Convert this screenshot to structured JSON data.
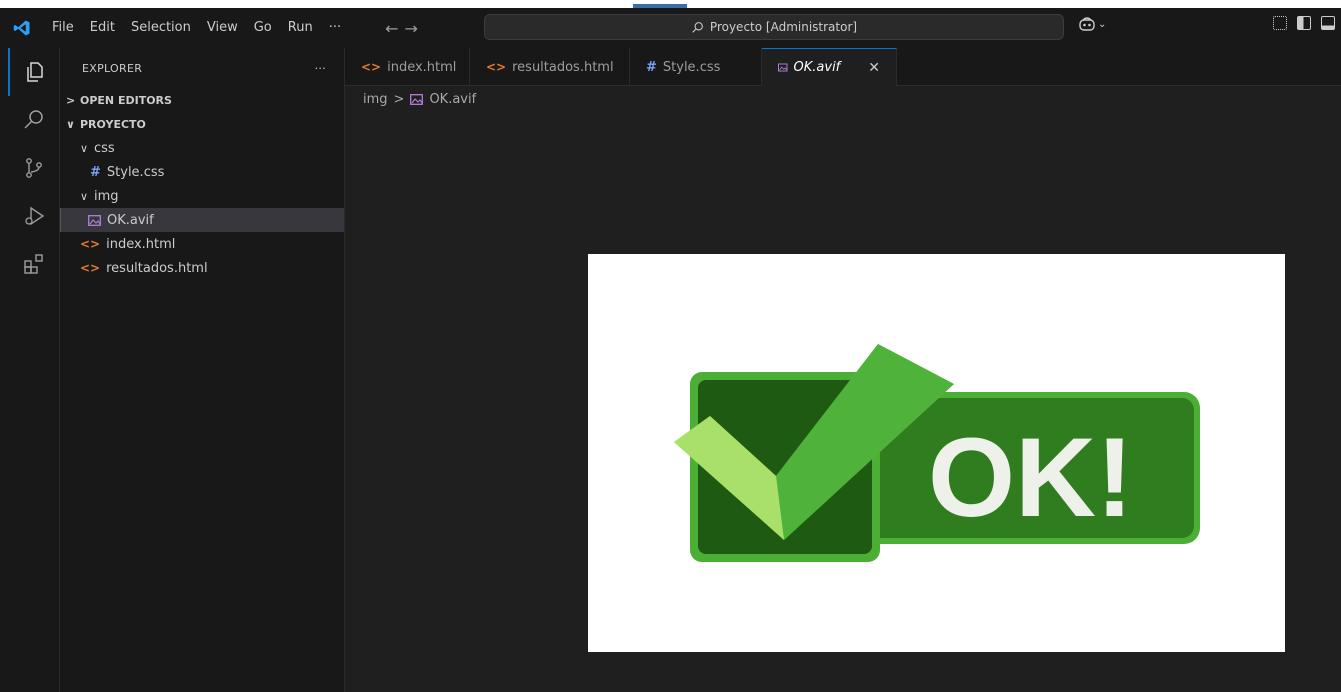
{
  "menu": {
    "items": [
      "File",
      "Edit",
      "Selection",
      "View",
      "Go",
      "Run",
      "···"
    ]
  },
  "search": {
    "text": "Proyecto [Administrator]"
  },
  "sidebar": {
    "title": "EXPLORER",
    "more": "···",
    "open_editors": "OPEN EDITORS",
    "project": "PROYECTO",
    "tree": {
      "css_folder": "css",
      "style_css": "Style.css",
      "img_folder": "img",
      "ok_avif": "OK.avif",
      "index_html": "index.html",
      "resultados_html": "resultados.html"
    }
  },
  "tabs": [
    {
      "label": "index.html"
    },
    {
      "label": "resultados.html"
    },
    {
      "label": "Style.css"
    },
    {
      "label": "OK.avif"
    }
  ],
  "breadcrumb": {
    "folder": "img",
    "file": "OK.avif"
  },
  "image": {
    "text": "OK!"
  },
  "colors": {
    "accent": "#0078d4",
    "html_icon": "#e37933",
    "css_icon": "#7aa2f7",
    "green_dark": "#2f7d1e",
    "green_light": "#8fd14f"
  }
}
